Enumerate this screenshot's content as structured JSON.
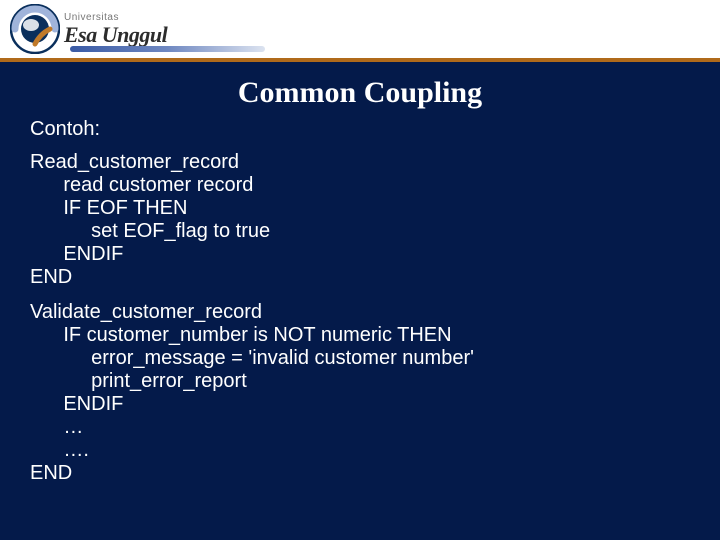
{
  "header": {
    "logo_uni": "Universitas",
    "logo_name": "Esa Unggul"
  },
  "slide": {
    "title": "Common Coupling",
    "subtitle": "Contoh:",
    "code1": "Read_customer_record\n      read customer record\n      IF EOF THEN\n           set EOF_flag to true\n      ENDIF\nEND",
    "code2": "Validate_customer_record\n      IF customer_number is NOT numeric THEN\n           error_message = 'invalid customer number'\n           print_error_report\n      ENDIF\n      …\n      ….\nEND"
  }
}
